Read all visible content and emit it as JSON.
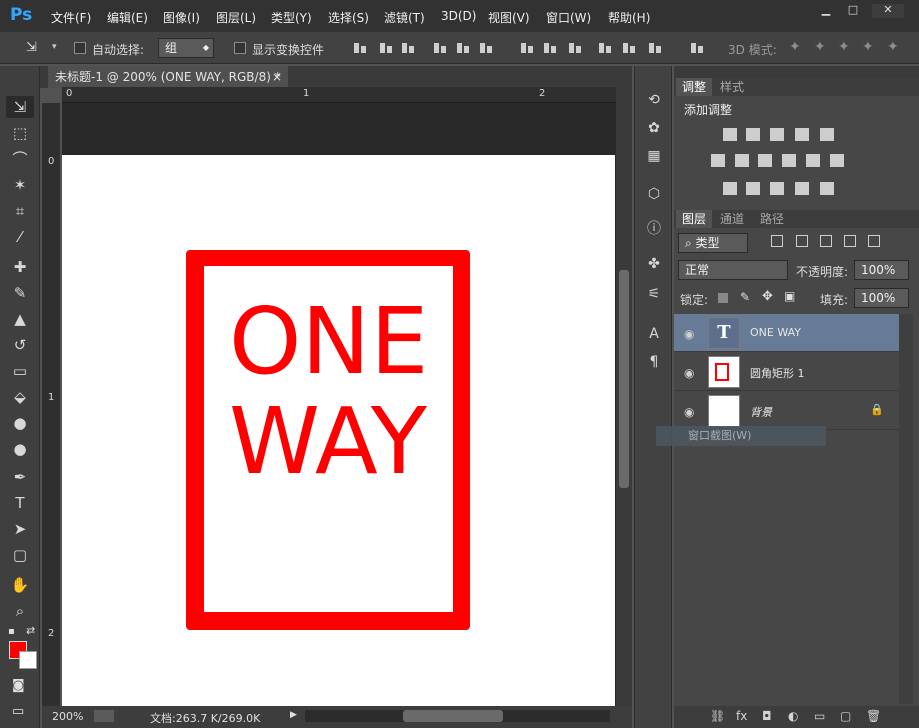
{
  "app": {
    "logo": "Ps"
  },
  "menus": [
    "文件(F)",
    "编辑(E)",
    "图像(I)",
    "图层(L)",
    "类型(Y)",
    "选择(S)",
    "滤镜(T)",
    "3D(D)",
    "视图(V)",
    "窗口(W)",
    "帮助(H)"
  ],
  "window_buttons": {
    "minimize": "▁",
    "maximize": "□",
    "close": "✕"
  },
  "options": {
    "auto_select_label": "自动选择:",
    "auto_select_value": "组",
    "show_transform_label": "显示变换控件",
    "mode_3d_label": "3D 模式:"
  },
  "document": {
    "tab_title": "未标题-1 @ 200% (ONE WAY, RGB/8) *",
    "close": "×",
    "ruler_h": [
      "0",
      "1",
      "2"
    ],
    "ruler_v": [
      "0",
      "1",
      "2"
    ]
  },
  "canvas": {
    "line1": "ONE",
    "line2": "WAY",
    "text_color": "#ff0000",
    "frame_color": "#ff0000"
  },
  "status": {
    "zoom": "200%",
    "doc_info": "文档:263.7 K/269.0K"
  },
  "adjustments_panel": {
    "tabs": [
      "调整",
      "样式"
    ],
    "title": "添加调整"
  },
  "layers_panel": {
    "tabs": [
      "图层",
      "通道",
      "路径"
    ],
    "filter_kind": "类型",
    "blend_mode": "正常",
    "opacity_label": "不透明度:",
    "opacity_value": "100%",
    "lock_label": "锁定:",
    "fill_label": "填充:",
    "fill_value": "100%",
    "layers": [
      {
        "name": "ONE WAY",
        "type": "text",
        "selected": true
      },
      {
        "name": "圆角矩形 1",
        "type": "shape",
        "selected": false
      },
      {
        "name": "背景",
        "type": "background",
        "selected": false,
        "locked": true
      }
    ],
    "tooltip": "窗口截图(W)"
  }
}
